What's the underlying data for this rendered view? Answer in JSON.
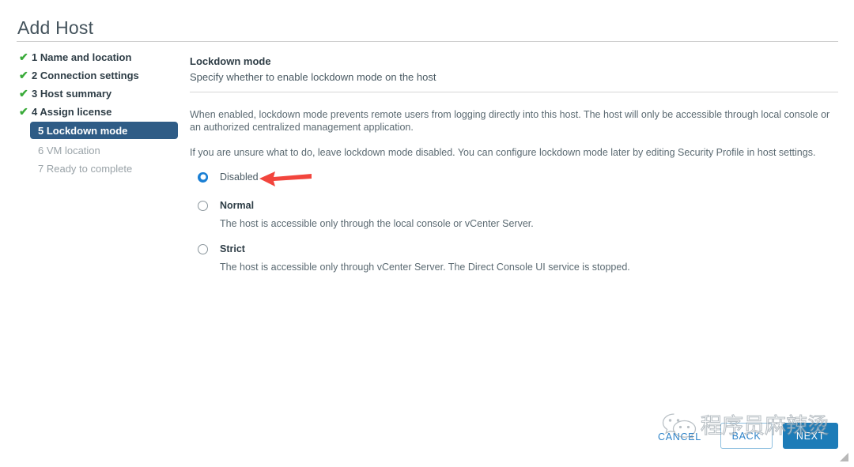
{
  "window": {
    "title": "Add Host"
  },
  "steps": [
    {
      "label": "1 Name and location",
      "state": "done",
      "icon": "check-icon"
    },
    {
      "label": "2 Connection settings",
      "state": "done",
      "icon": "check-icon"
    },
    {
      "label": "3 Host summary",
      "state": "done",
      "icon": "check-icon"
    },
    {
      "label": "4 Assign license",
      "state": "done",
      "icon": "check-icon"
    },
    {
      "label": "5 Lockdown mode",
      "state": "current",
      "icon": ""
    },
    {
      "label": "6 VM location",
      "state": "pending",
      "icon": ""
    },
    {
      "label": "7 Ready to complete",
      "state": "pending",
      "icon": ""
    }
  ],
  "content": {
    "section_title": "Lockdown mode",
    "section_subtitle": "Specify whether to enable lockdown mode on the host",
    "paragraph_1": "When enabled, lockdown mode prevents remote users from logging directly into this host. The host will only be accessible through local console or an authorized centralized management application.",
    "paragraph_2": "If you are unsure what to do, leave lockdown mode disabled. You can configure lockdown mode later by editing Security Profile in host settings."
  },
  "options": {
    "selected": "Disabled",
    "items": [
      {
        "label": "Disabled",
        "description": "",
        "selected": true
      },
      {
        "label": "Normal",
        "description": "The host is accessible only through the local console or vCenter Server.",
        "selected": false
      },
      {
        "label": "Strict",
        "description": "The host is accessible only through vCenter Server. The Direct Console UI service is stopped.",
        "selected": false
      }
    ]
  },
  "footer": {
    "cancel_label": "CANCEL",
    "back_label": "BACK",
    "next_label": "NEXT"
  },
  "watermark": {
    "text": "程序员麻辣烫",
    "logo": "wechat-logo-icon"
  },
  "colors": {
    "accent_blue": "#1d7cb8",
    "current_step_bg": "#2f5c86",
    "check_green": "#3aab3a",
    "radio_selected": "#1a7fd4",
    "annotation_red": "#f2453d"
  }
}
